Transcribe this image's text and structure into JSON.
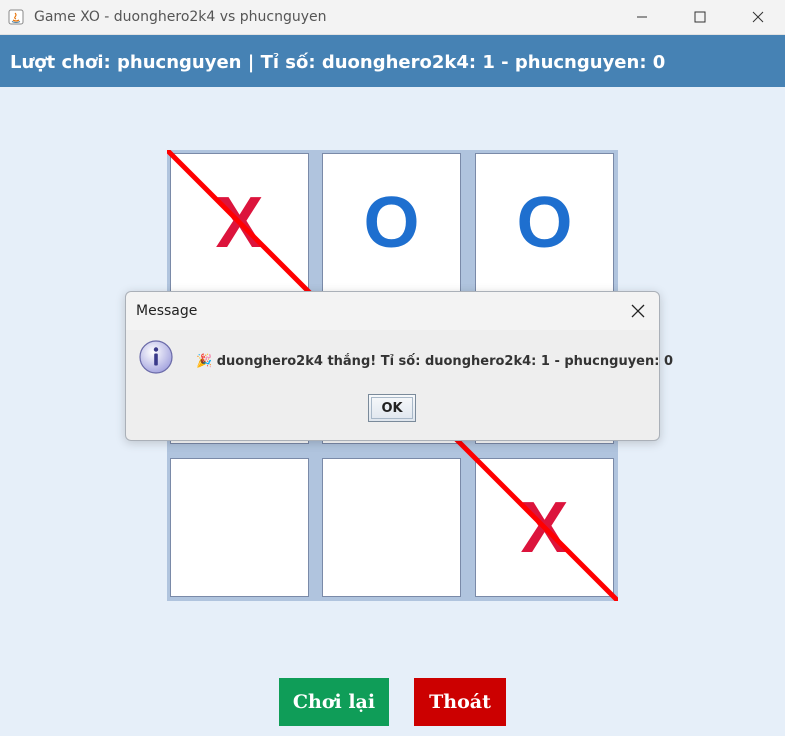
{
  "window": {
    "title": "Game XO - duonghero2k4 vs phucnguyen"
  },
  "header": {
    "status": "Lượt chơi: phucnguyen | Tỉ số: duonghero2k4: 1 - phucnguyen: 0"
  },
  "board": {
    "cells": [
      "X",
      "O",
      "O",
      "",
      "",
      "",
      "",
      "",
      "X"
    ],
    "winning_line": "main-diagonal",
    "colors": {
      "x": "#dc143c",
      "o": "#1e6fcf",
      "line": "#ff0000",
      "grid": "#b0c4de"
    }
  },
  "actions": {
    "replay_label": "Chơi lại",
    "exit_label": "Thoát"
  },
  "dialog": {
    "title": "Message",
    "message": "🎉 duonghero2k4 thắng! Tỉ số: duonghero2k4: 1 - phucnguyen: 0",
    "ok_label": "OK"
  },
  "icons": {
    "app": "java-app-icon",
    "info": "info-icon"
  }
}
